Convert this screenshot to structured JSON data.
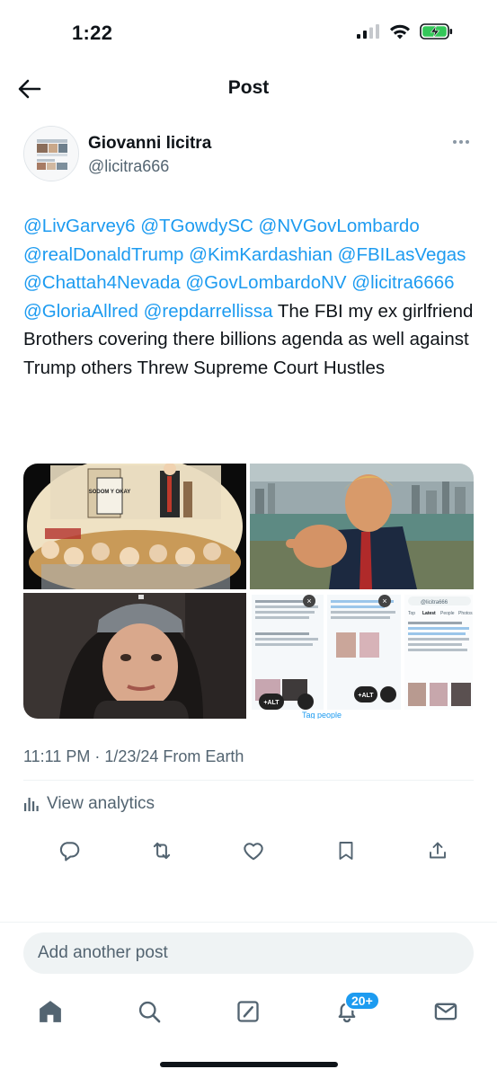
{
  "status_bar": {
    "time": "1:22"
  },
  "nav": {
    "title": "Post"
  },
  "author": {
    "name": "Giovanni licitra",
    "handle": "@licitra666"
  },
  "post": {
    "mentions": [
      "@LivGarvey6",
      "@TGowdySC",
      "@NVGovLombardo",
      "@realDonaldTrump",
      "@KimKardashian",
      "@FBILasVegas",
      "@Chattah4Nevada",
      "@GovLombardoNV",
      "@licitra6666",
      "@GloriaAllred",
      "@repdarrellissa"
    ],
    "body": "The FBI my ex girlfriend Brothers covering there billions agenda as well against Trump others Threw Supreme Court Hustles",
    "timestamp": "11:11 PM · 1/23/24 From Earth"
  },
  "media": {
    "cartoon_newspaper": "SODOM Y OKAY",
    "screenshot": {
      "alt_label": "+ALT",
      "tag_people": "Tag people",
      "search_query": "@licitra666",
      "tabs": [
        "Top",
        "Latest",
        "People",
        "Photos"
      ]
    }
  },
  "analytics": {
    "label": "View analytics"
  },
  "reply": {
    "placeholder": "Add another post"
  },
  "notifications": {
    "badge": "20+"
  },
  "icons": {
    "back": "arrow-left-icon",
    "more": "more-dots-icon",
    "analytics": "bar-chart-icon",
    "reply": "reply-icon",
    "repost": "repost-icon",
    "like": "heart-icon",
    "bookmark": "bookmark-icon",
    "share": "share-icon",
    "home": "home-icon",
    "search": "search-icon",
    "compose": "compose-icon",
    "notifications": "bell-icon",
    "messages": "mail-icon"
  },
  "colors": {
    "accent": "#1d9bf0",
    "text": "#0f1419",
    "secondary": "#536471"
  }
}
